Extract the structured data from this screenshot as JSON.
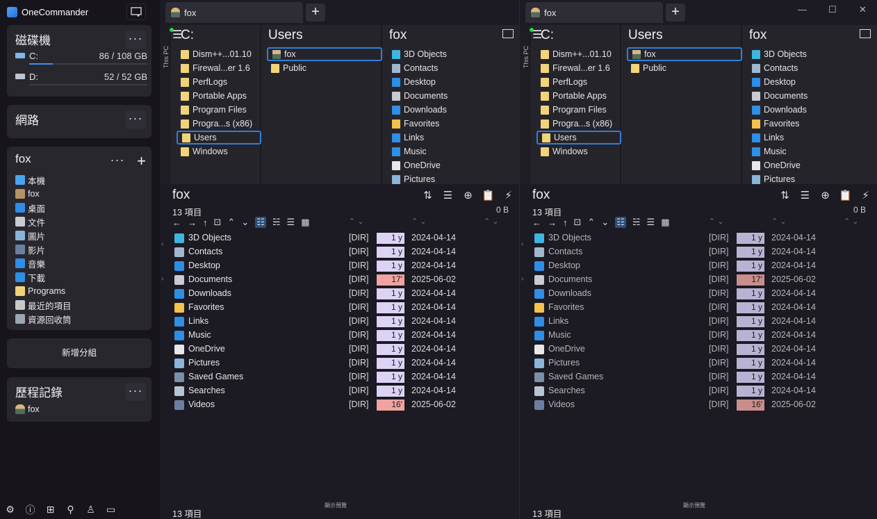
{
  "app": {
    "title": "OneCommander"
  },
  "sidebar": {
    "drives_title": "磁碟機",
    "drives": [
      {
        "name": "C:",
        "size": "86 / 108 GB",
        "used_fraction": 0.2
      },
      {
        "name": "D:",
        "size": "52 / 52 GB",
        "used_fraction": 0.0
      }
    ],
    "network_title": "網路",
    "favorites_title": "fox",
    "favorites": [
      {
        "label": "本機",
        "icon": "computer-icon",
        "color": "#4aa3f0"
      },
      {
        "label": "fox",
        "icon": "user-icon",
        "color": "#b39366"
      },
      {
        "label": "桌面",
        "icon": "desktop-icon",
        "color": "#2e8ee6"
      },
      {
        "label": "文件",
        "icon": "documents-icon",
        "color": "#c8ccd2"
      },
      {
        "label": "圖片",
        "icon": "pictures-icon",
        "color": "#8ab4d8"
      },
      {
        "label": "影片",
        "icon": "videos-icon",
        "color": "#6c7fa3"
      },
      {
        "label": "音樂",
        "icon": "music-icon",
        "color": "#2f8ee5"
      },
      {
        "label": "下載",
        "icon": "downloads-icon",
        "color": "#2f8ee5"
      },
      {
        "label": "Programs",
        "icon": "folder-icon",
        "color": "#f1d37a"
      },
      {
        "label": "最近的項目",
        "icon": "recent-icon",
        "color": "#c9c9c9"
      },
      {
        "label": "資源回收筒",
        "icon": "recycle-bin-icon",
        "color": "#9aa7b3"
      }
    ],
    "add_group": "新增分組",
    "history_title": "歷程記錄",
    "history": [
      {
        "label": "fox",
        "icon": "user-icon"
      }
    ]
  },
  "panes": [
    {
      "tab": "fox",
      "this_pc": "This PC",
      "drive_col_title": "C:",
      "drive_col_items": [
        "Dism++...01.10",
        "Firewal...er 1.6",
        "PerfLogs",
        "Portable Apps",
        "Program Files",
        "Progra...s (x86)",
        "Users",
        "Windows"
      ],
      "users_col_title": "Users",
      "users_col_items": [
        "fox",
        "Public"
      ],
      "fox_col_title": "fox",
      "fox_col_items": [
        "3D Objects",
        "Contacts",
        "Desktop",
        "Documents",
        "Downloads",
        "Favorites",
        "Links",
        "Music",
        "OneDrive",
        "Pictures"
      ],
      "header": "fox",
      "count": "13 項目",
      "size": "0 B",
      "preview": "顯示預覽"
    },
    {
      "tab": "fox",
      "this_pc": "This PC",
      "drive_col_title": "C:",
      "drive_col_items": [
        "Dism++...01.10",
        "Firewal...er 1.6",
        "PerfLogs",
        "Portable Apps",
        "Program Files",
        "Progra...s (x86)",
        "Users",
        "Windows"
      ],
      "users_col_title": "Users",
      "users_col_items": [
        "fox",
        "Public"
      ],
      "fox_col_title": "fox",
      "fox_col_items": [
        "3D Objects",
        "Contacts",
        "Desktop",
        "Documents",
        "Downloads",
        "Favorites",
        "Links",
        "Music",
        "OneDrive",
        "Pictures"
      ],
      "header": "fox",
      "count": "13 項目",
      "size": "0 B",
      "preview": "顯示預覽"
    }
  ],
  "files": [
    {
      "name": "3D Objects",
      "type": "[DIR]",
      "age": "1 y",
      "date": "2024-04-14",
      "recent": false,
      "color": "#3fb6e0"
    },
    {
      "name": "Contacts",
      "type": "[DIR]",
      "age": "1 y",
      "date": "2024-04-14",
      "recent": false,
      "color": "#9fb8d0"
    },
    {
      "name": "Desktop",
      "type": "[DIR]",
      "age": "1 y",
      "date": "2024-04-14",
      "recent": false,
      "color": "#2e8ee6"
    },
    {
      "name": "Documents",
      "type": "[DIR]",
      "age": "17'",
      "date": "2025-06-02",
      "recent": true,
      "color": "#c8ccd2"
    },
    {
      "name": "Downloads",
      "type": "[DIR]",
      "age": "1 y",
      "date": "2024-04-14",
      "recent": false,
      "color": "#2f8ee5"
    },
    {
      "name": "Favorites",
      "type": "[DIR]",
      "age": "1 y",
      "date": "2024-04-14",
      "recent": false,
      "color": "#f2c14e"
    },
    {
      "name": "Links",
      "type": "[DIR]",
      "age": "1 y",
      "date": "2024-04-14",
      "recent": false,
      "color": "#2f8ee5"
    },
    {
      "name": "Music",
      "type": "[DIR]",
      "age": "1 y",
      "date": "2024-04-14",
      "recent": false,
      "color": "#2f8ee5"
    },
    {
      "name": "OneDrive",
      "type": "[DIR]",
      "age": "1 y",
      "date": "2024-04-14",
      "recent": false,
      "color": "#e8e8e8"
    },
    {
      "name": "Pictures",
      "type": "[DIR]",
      "age": "1 y",
      "date": "2024-04-14",
      "recent": false,
      "color": "#8ab4d8"
    },
    {
      "name": "Saved Games",
      "type": "[DIR]",
      "age": "1 y",
      "date": "2024-04-14",
      "recent": false,
      "color": "#7a8fa8"
    },
    {
      "name": "Searches",
      "type": "[DIR]",
      "age": "1 y",
      "date": "2024-04-14",
      "recent": false,
      "color": "#b7c4d2"
    },
    {
      "name": "Videos",
      "type": "[DIR]",
      "age": "16'",
      "date": "2025-06-02",
      "recent": true,
      "color": "#6c7fa3"
    }
  ],
  "colors": {
    "accent": "#2f7fd8",
    "age_old": "#dcd3f5",
    "age_recent": "#f0a3a0",
    "age_old_dim": "#b9b3d3",
    "age_recent_dim": "#c98d8b"
  }
}
